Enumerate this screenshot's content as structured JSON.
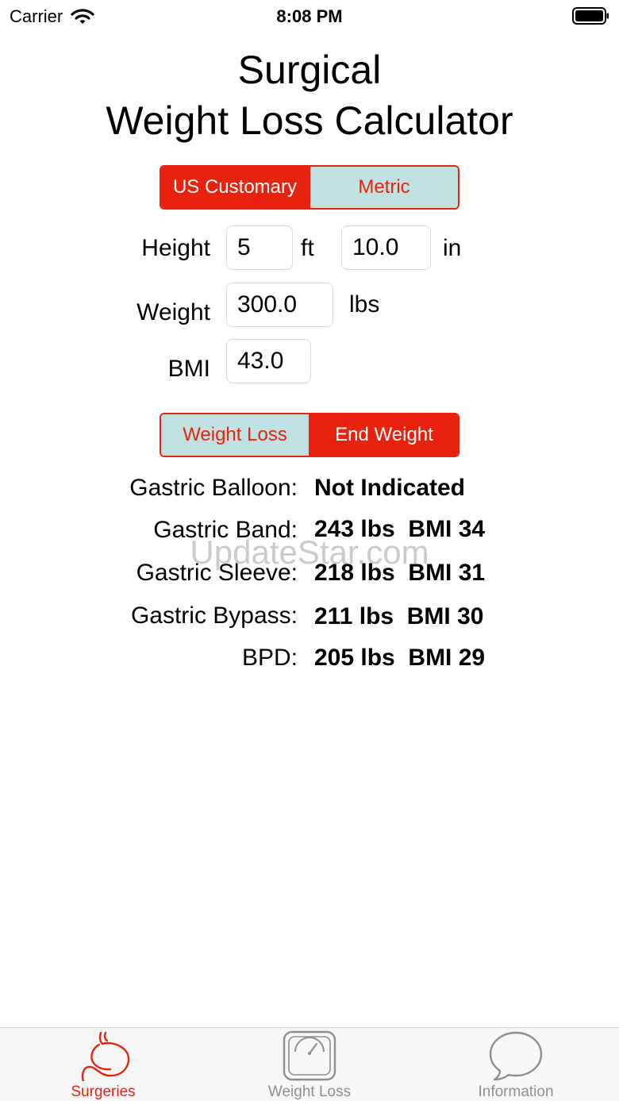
{
  "status_bar": {
    "carrier": "Carrier",
    "time": "8:08 PM"
  },
  "title": {
    "line1": "Surgical",
    "line2": "Weight Loss Calculator"
  },
  "unit_toggle": {
    "us": "US Customary",
    "metric": "Metric"
  },
  "inputs": {
    "height_label": "Height",
    "height_ft": "5",
    "ft_unit": "ft",
    "height_in": "10.0",
    "in_unit": "in",
    "weight_label": "Weight",
    "weight": "300.0",
    "weight_unit": "lbs",
    "bmi_label": "BMI",
    "bmi": "43.0"
  },
  "mode_toggle": {
    "weight_loss": "Weight Loss",
    "end_weight": "End Weight"
  },
  "results": [
    {
      "label": "Gastric Balloon:",
      "value": "Not Indicated"
    },
    {
      "label": "Gastric Band:",
      "value": "243 lbs  BMI 34"
    },
    {
      "label": "Gastric Sleeve:",
      "value": "218 lbs  BMI 31"
    },
    {
      "label": "Gastric Bypass:",
      "value": "211 lbs  BMI 30"
    },
    {
      "label": "BPD:",
      "value": "205 lbs  BMI 29"
    }
  ],
  "watermark": "UpdateStar.com",
  "tabs": [
    {
      "label": "Surgeries",
      "icon": "stomach-icon"
    },
    {
      "label": "Weight Loss",
      "icon": "scale-icon"
    },
    {
      "label": "Information",
      "icon": "speech-bubble-icon"
    }
  ],
  "colors": {
    "accent": "#e8220e",
    "segment_off": "#bfe1e1",
    "tab_inactive": "#8e8e93"
  }
}
